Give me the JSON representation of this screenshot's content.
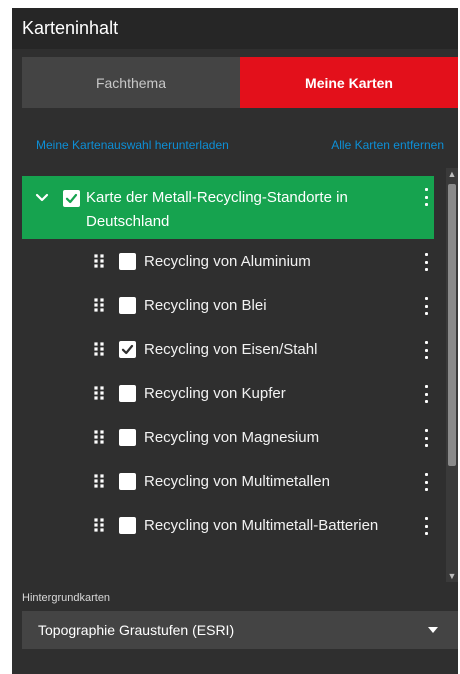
{
  "panel": {
    "title": "Karteninhalt"
  },
  "tabs": [
    {
      "label": "Fachthema",
      "active": false
    },
    {
      "label": "Meine Karten",
      "active": true
    }
  ],
  "links": {
    "download": "Meine Kartenauswahl herunterladen",
    "remove_all": "Alle Karten entfernen"
  },
  "group": {
    "title": "Karte der Metall-Recycling-Standorte in Deutschland",
    "checked": true,
    "expanded": true
  },
  "layers": [
    {
      "label": "Recycling von Aluminium",
      "checked": false
    },
    {
      "label": "Recycling von Blei",
      "checked": false
    },
    {
      "label": "Recycling von Eisen/Stahl",
      "checked": true
    },
    {
      "label": "Recycling von Kupfer",
      "checked": false
    },
    {
      "label": "Recycling von Magnesium",
      "checked": false
    },
    {
      "label": "Recycling von Multimetallen",
      "checked": false
    },
    {
      "label": "Recycling von Multimetall-Batterien",
      "checked": false
    }
  ],
  "basemap": {
    "label": "Hintergrundkarten",
    "selected": "Topographie Graustufen (ESRI)"
  },
  "colors": {
    "accent_red": "#e3101b",
    "group_green": "#16a34f",
    "link_blue": "#0d8fd6",
    "panel_bg": "#2f2f2f"
  },
  "icons": {
    "expand": "chevron-down-icon",
    "checkbox": "checkbox-icon",
    "drag": "drag-handle-icon",
    "menu": "more-vertical-icon",
    "dropdown": "caret-down-icon"
  }
}
